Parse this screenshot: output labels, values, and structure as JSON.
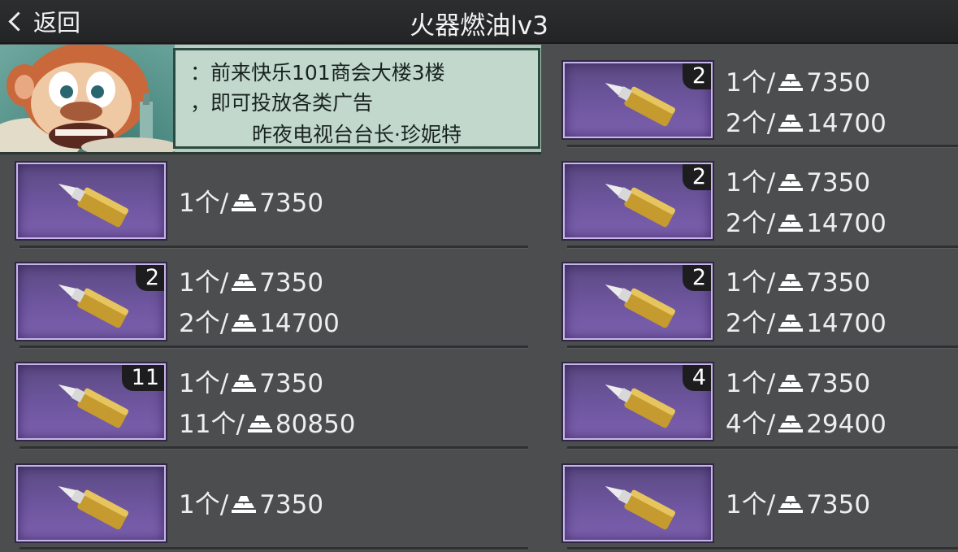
{
  "header": {
    "back_label": "返回",
    "title": "火器燃油lv3"
  },
  "ad": {
    "line1": "：前来快乐101商会大楼3楼",
    "line2": "，即可投放各类广告",
    "line3": "昨夜电视台台长·珍妮特"
  },
  "price_sep": "/",
  "listings": [
    {
      "badge": "",
      "unit_count": "1个",
      "unit_price": "7350",
      "total_count": "",
      "total_price": ""
    },
    {
      "badge": "2",
      "unit_count": "1个",
      "unit_price": "7350",
      "total_count": "2个",
      "total_price": "14700"
    },
    {
      "badge": "11",
      "unit_count": "1个",
      "unit_price": "7350",
      "total_count": "11个",
      "total_price": "80850"
    },
    {
      "badge": "",
      "unit_count": "1个",
      "unit_price": "7350",
      "total_count": "",
      "total_price": ""
    },
    {
      "badge": "2",
      "unit_count": "1个",
      "unit_price": "7350",
      "total_count": "2个",
      "total_price": "14700"
    },
    {
      "badge": "2",
      "unit_count": "1个",
      "unit_price": "7350",
      "total_count": "2个",
      "total_price": "14700"
    },
    {
      "badge": "2",
      "unit_count": "1个",
      "unit_price": "7350",
      "total_count": "2个",
      "total_price": "14700"
    },
    {
      "badge": "4",
      "unit_count": "1个",
      "unit_price": "7350",
      "total_count": "4个",
      "total_price": "29400"
    },
    {
      "badge": "",
      "unit_count": "1个",
      "unit_price": "7350",
      "total_count": "",
      "total_price": ""
    }
  ],
  "icons": {
    "back": "chevron-left-icon",
    "currency": "gold-bars-icon",
    "item": "fuel-bottle-icon"
  },
  "colors": {
    "item_frame": "#c8b4ec",
    "item_bg": "#6f56a0",
    "background": "#4b4d4f",
    "header": "#28292b"
  }
}
